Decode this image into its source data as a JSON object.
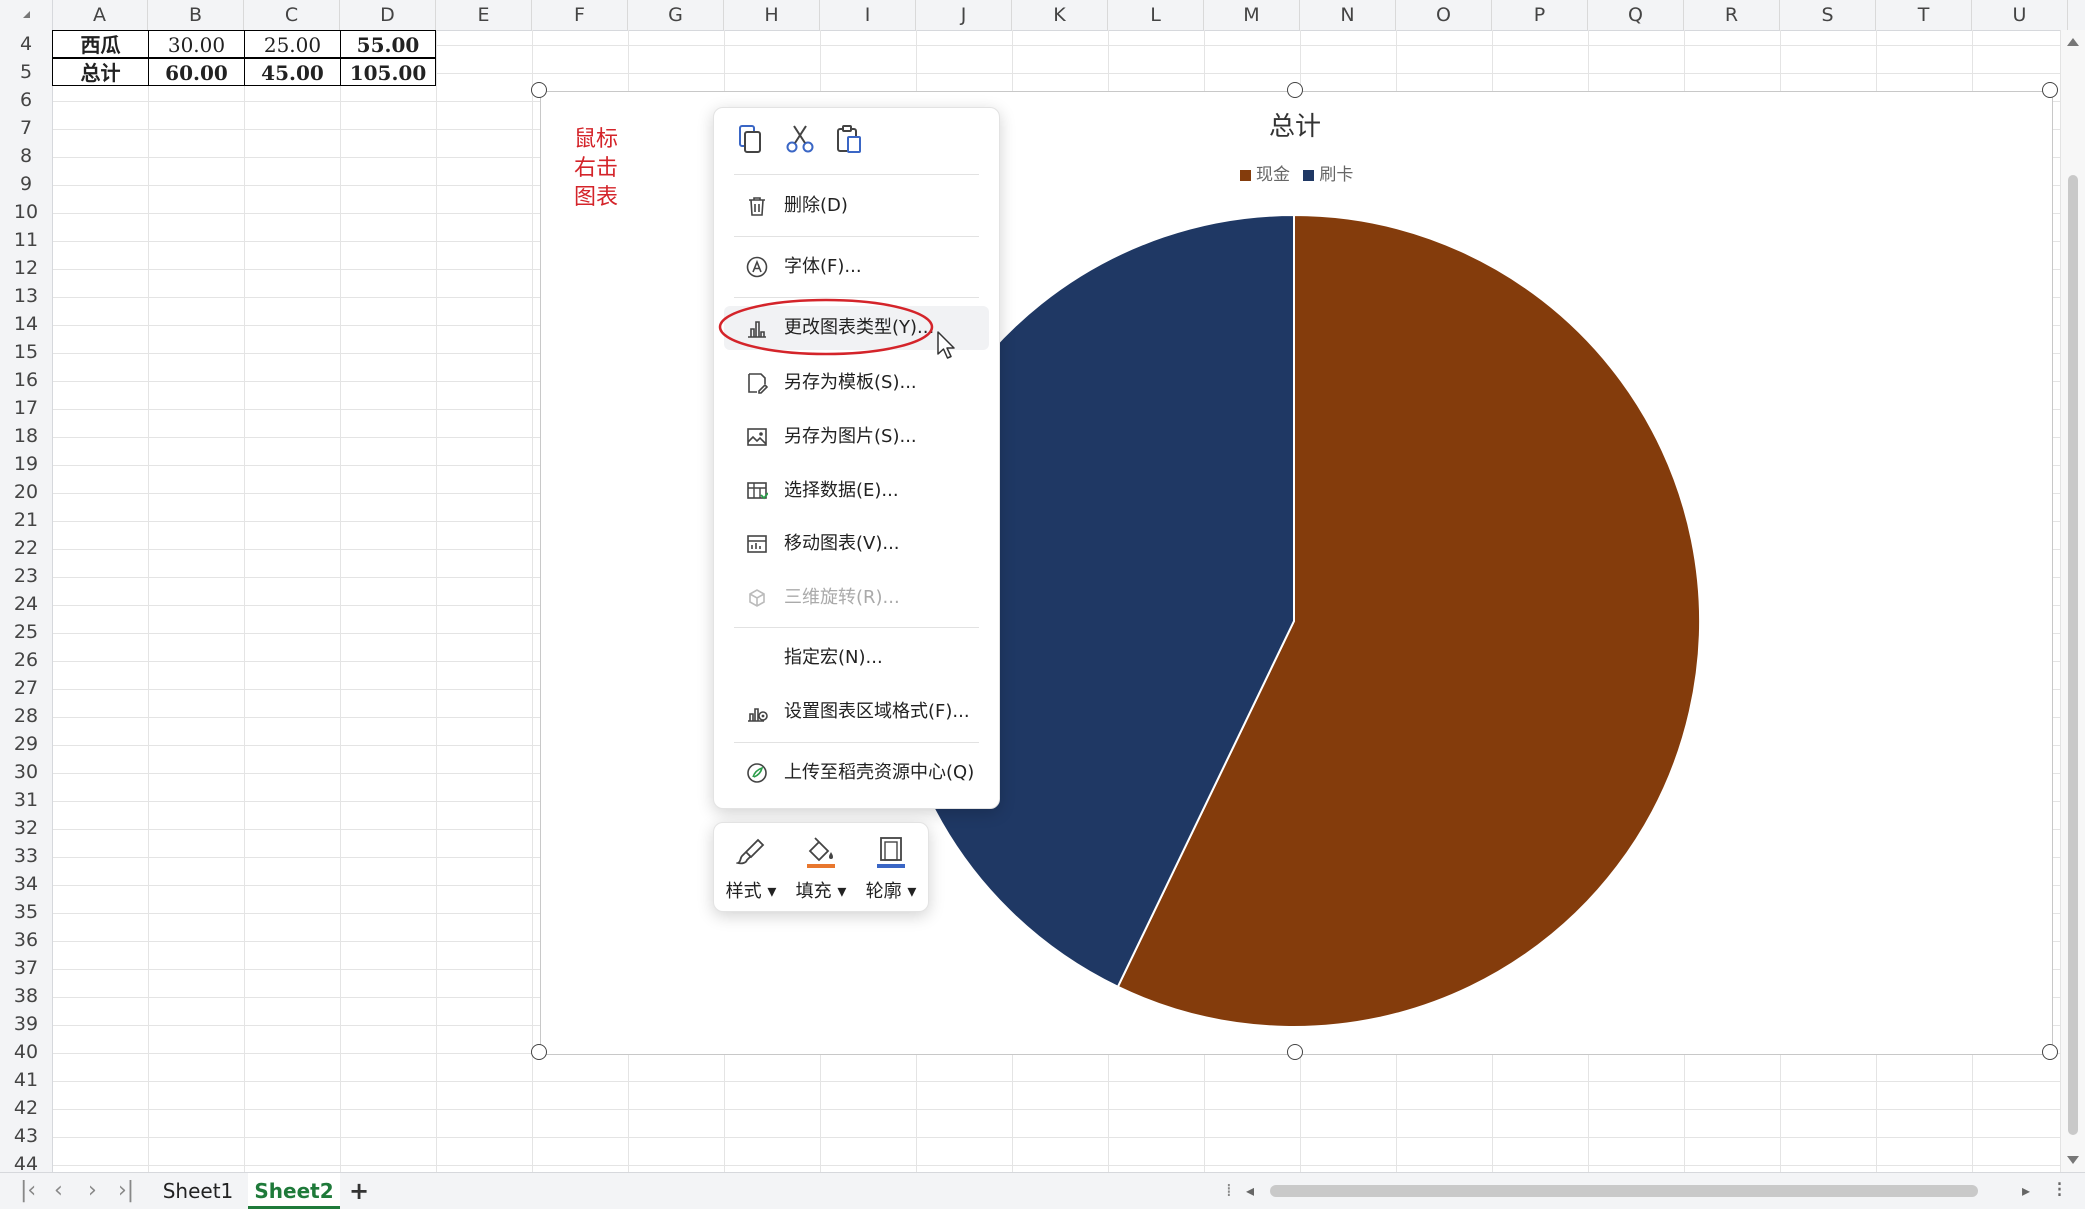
{
  "columns": [
    "A",
    "B",
    "C",
    "D",
    "E",
    "F",
    "G",
    "H",
    "I",
    "J",
    "K",
    "L",
    "M",
    "N",
    "O",
    "P",
    "Q",
    "R",
    "S",
    "T",
    "U"
  ],
  "rows": [
    "4",
    "5",
    "6",
    "7",
    "8",
    "9",
    "10",
    "11",
    "12",
    "13",
    "14",
    "15",
    "16",
    "17",
    "18",
    "19",
    "20",
    "21",
    "22",
    "23",
    "24",
    "25",
    "26",
    "27",
    "28",
    "29",
    "30",
    "31",
    "32",
    "33",
    "34",
    "35",
    "36",
    "37",
    "38",
    "39",
    "40",
    "41",
    "42",
    "43",
    "44"
  ],
  "table": {
    "row4": [
      "西瓜",
      "30.00",
      "25.00",
      "55.00"
    ],
    "row5": [
      "总计",
      "60.00",
      "45.00",
      "105.00"
    ]
  },
  "chart_data": {
    "type": "pie",
    "title": "总计",
    "categories": [
      "现金",
      "刷卡"
    ],
    "values": [
      60,
      45
    ],
    "colors": [
      "#843c0c",
      "#1f3864"
    ],
    "legend_position": "top"
  },
  "annotation": "鼠标右击图表",
  "context_menu": {
    "toolbar_icons": [
      "copy-icon",
      "cut-icon",
      "paste-icon"
    ],
    "items": [
      {
        "label": "删除(D)",
        "icon": "trash-icon"
      },
      {
        "label": "字体(F)...",
        "icon": "font-icon"
      },
      {
        "label": "更改图表类型(Y)...",
        "icon": "bar-chart-icon",
        "highlighted": true
      },
      {
        "label": "另存为模板(S)...",
        "icon": "save-template-icon"
      },
      {
        "label": "另存为图片(S)...",
        "icon": "save-image-icon"
      },
      {
        "label": "选择数据(E)...",
        "icon": "select-data-icon"
      },
      {
        "label": "移动图表(V)...",
        "icon": "move-chart-icon"
      },
      {
        "label": "三维旋转(R)...",
        "icon": "3d-rotate-icon",
        "disabled": true
      },
      {
        "label": "指定宏(N)...",
        "icon": ""
      },
      {
        "label": "设置图表区域格式(F)...",
        "icon": "format-area-icon"
      },
      {
        "label": "上传至稻壳资源中心(Q)",
        "icon": "upload-icon"
      }
    ]
  },
  "format_bar": [
    "样式",
    "填充",
    "轮廓"
  ],
  "sheets": [
    "Sheet1",
    "Sheet2"
  ],
  "active_sheet": "Sheet2",
  "add_sheet": "+"
}
